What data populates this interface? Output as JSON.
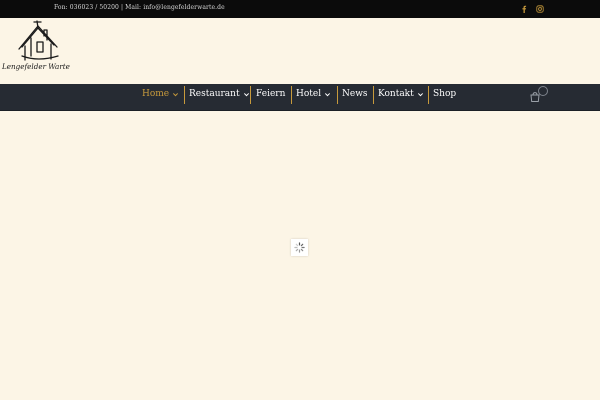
{
  "topbar": {
    "contact": "Fon: 036023 / 50200 | Mail: info@lengefelderwarte.de",
    "social": [
      {
        "icon": "facebook-icon"
      },
      {
        "icon": "instagram-icon"
      }
    ]
  },
  "logo": {
    "text": "Lengefelder Warte"
  },
  "nav": {
    "items": [
      {
        "label": "Home"
      },
      {
        "label": "Restaurant"
      },
      {
        "label": "Feiern"
      },
      {
        "label": "Hotel"
      },
      {
        "label": "News"
      },
      {
        "label": "Kontakt"
      },
      {
        "label": "Shop"
      }
    ],
    "cart_icon": "cart-icon"
  },
  "colors": {
    "accent": "#c79a3c",
    "navbar": "#262b33",
    "topbar": "#0b0b0b",
    "background": "#fcf5e6"
  },
  "loader": {
    "icon": "spinner-icon"
  }
}
